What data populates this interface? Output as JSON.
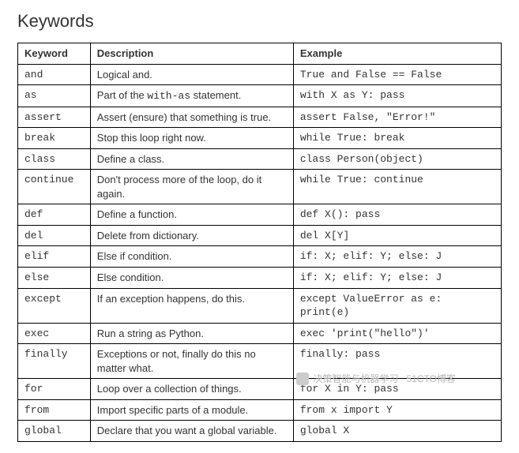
{
  "title": "Keywords",
  "headers": {
    "c1": "Keyword",
    "c2": "Description",
    "c3": "Example"
  },
  "rows": [
    {
      "keyword": "and",
      "description": "Logical and.",
      "example": "True and False == False"
    },
    {
      "keyword": "as",
      "description": "Part of the with-as statement.",
      "example": "with X as Y: pass",
      "desc_has_code": true,
      "desc_code": "with-as",
      "desc_pre": "Part of the ",
      "desc_post": " statement."
    },
    {
      "keyword": "assert",
      "description": "Assert (ensure) that something is true.",
      "example": "assert False, \"Error!\""
    },
    {
      "keyword": "break",
      "description": "Stop this loop right now.",
      "example": "while True: break"
    },
    {
      "keyword": "class",
      "description": "Define a class.",
      "example": "class Person(object)"
    },
    {
      "keyword": "continue",
      "description": "Don't process more of the loop, do it again.",
      "example": "while True: continue"
    },
    {
      "keyword": "def",
      "description": "Define a function.",
      "example": "def X(): pass"
    },
    {
      "keyword": "del",
      "description": "Delete from dictionary.",
      "example": "del X[Y]"
    },
    {
      "keyword": "elif",
      "description": "Else if condition.",
      "example": "if: X; elif: Y; else: J"
    },
    {
      "keyword": "else",
      "description": "Else condition.",
      "example": "if: X; elif: Y; else: J"
    },
    {
      "keyword": "except",
      "description": "If an exception happens, do this.",
      "example": "except ValueError as e: print(e)"
    },
    {
      "keyword": "exec",
      "description": "Run a string as Python.",
      "example": "exec 'print(\"hello\")'"
    },
    {
      "keyword": "finally",
      "description": "Exceptions or not, finally do this no matter what.",
      "example": "finally: pass"
    },
    {
      "keyword": "for",
      "description": "Loop over a collection of things.",
      "example": "for X in Y: pass"
    },
    {
      "keyword": "from",
      "description": "Import specific parts of a module.",
      "example": "from x import Y"
    },
    {
      "keyword": "global",
      "description": "Declare that you want a global variable.",
      "example": "global X"
    }
  ],
  "watermark": {
    "text": "决策智能与机器学习",
    "sub": "51CTO博客"
  }
}
